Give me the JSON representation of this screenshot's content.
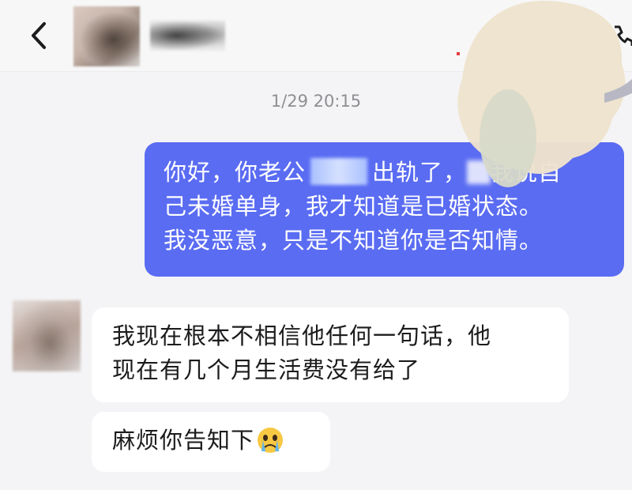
{
  "header": {
    "back_icon": "chevron-left-icon",
    "call_icon": "phone-icon"
  },
  "chat": {
    "timestamp": "1/29 20:15",
    "outgoing": {
      "line1_a": "你好，你老公",
      "line1_b": "出轨了，",
      "line1_c": "我说自",
      "line2": "己未婚单身，我才知道是已婚状态。",
      "line3": "我没恶意，只是不知道你是否知情。"
    },
    "incoming": [
      {
        "line1": "我现在根本不相信他任何一句话，他",
        "line2": "现在有几个月生活费没有给了"
      },
      {
        "text": "麻烦你告知下",
        "emoji": "crying-face-emoji"
      }
    ]
  },
  "colors": {
    "outgoing_bubble": "#5a6cf2",
    "incoming_bubble": "#ffffff",
    "background": "#f4f4f6"
  }
}
